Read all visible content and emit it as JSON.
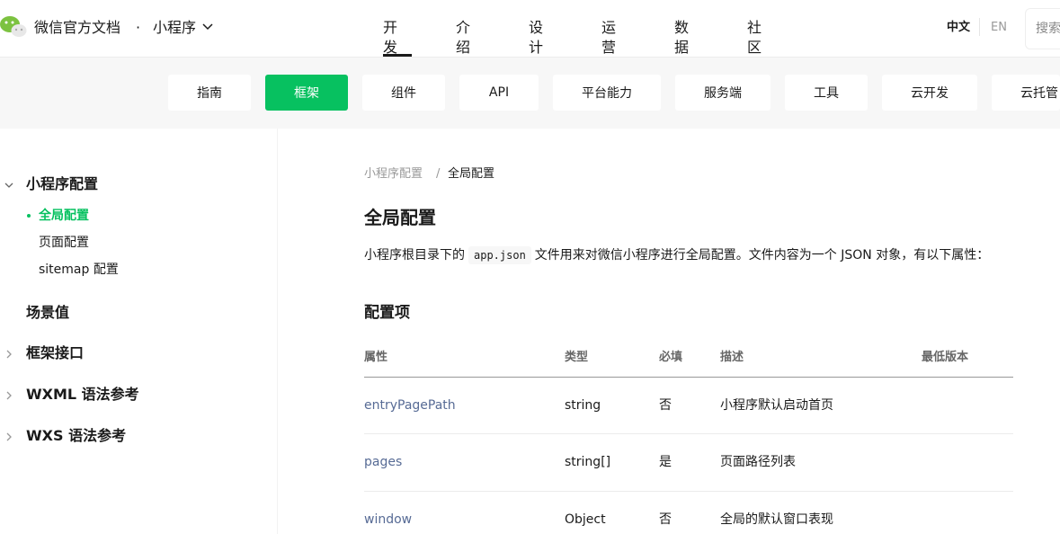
{
  "header": {
    "brand": "微信官方文档",
    "dot": "·",
    "product": "小程序",
    "nav": [
      "开发",
      "介绍",
      "设计",
      "运营",
      "数据",
      "社区"
    ],
    "lang_zh": "中文",
    "lang_en": "EN",
    "search_placeholder": "搜索"
  },
  "subnav": [
    "指南",
    "框架",
    "组件",
    "API",
    "平台能力",
    "服务端",
    "工具",
    "云开发",
    "云托管"
  ],
  "sidebar": {
    "group1": "小程序配置",
    "items": [
      "全局配置",
      "页面配置",
      "sitemap 配置"
    ],
    "group2": "场景值",
    "group3": "框架接口",
    "group4": "WXML 语法参考",
    "group5": "WXS 语法参考"
  },
  "content": {
    "breadcrumb_parent": "小程序配置",
    "breadcrumb_sep": "/",
    "breadcrumb_current": "全局配置",
    "title": "全局配置",
    "intro_before": "小程序根目录下的",
    "intro_code": "app.json",
    "intro_after": "文件用来对微信小程序进行全局配置。文件内容为一个 JSON 对象，有以下属性：",
    "section_title": "配置项",
    "table": {
      "headers": [
        "属性",
        "类型",
        "必填",
        "描述",
        "最低版本"
      ],
      "rows": [
        [
          "entryPagePath",
          "string",
          "否",
          "小程序默认启动首页",
          ""
        ],
        [
          "pages",
          "string[]",
          "是",
          "页面路径列表",
          ""
        ],
        [
          "window",
          "Object",
          "否",
          "全局的默认窗口表现",
          ""
        ]
      ]
    }
  },
  "colors": {
    "accent": "#07c160",
    "link": "#576b95"
  }
}
